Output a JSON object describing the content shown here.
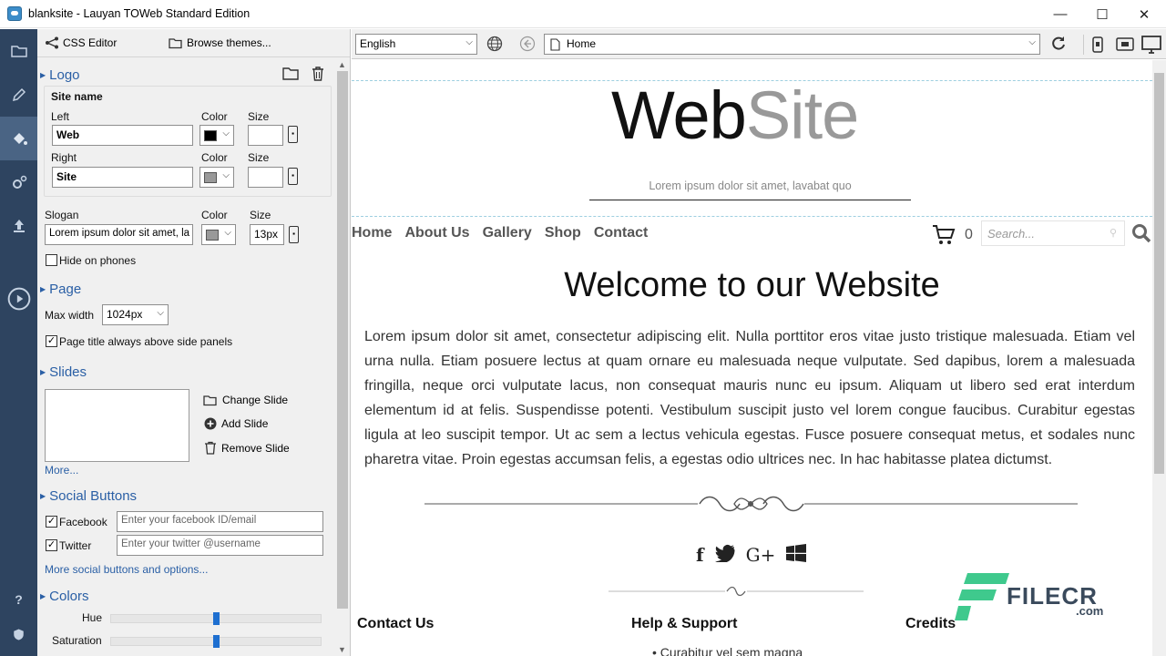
{
  "window": {
    "title": "blanksite - Lauyan TOWeb Standard Edition",
    "minimize": "—",
    "maximize": "☐",
    "close": "✕"
  },
  "panel_toolbar": {
    "css_editor": "CSS Editor",
    "browse_themes": "Browse themes..."
  },
  "logo": {
    "section": "Logo",
    "site_name": "Site name",
    "left_label": "Left",
    "left_value": "Web",
    "right_label": "Right",
    "right_value": "Site",
    "color_label": "Color",
    "size_label": "Size",
    "left_color": "#000000",
    "right_color": "#999999"
  },
  "slogan": {
    "label": "Slogan",
    "value": "Lorem ipsum dolor sit amet, la",
    "color_label": "Color",
    "size_label": "Size",
    "size_value": "13px",
    "color": "#999999",
    "hide_label": "Hide on phones"
  },
  "page": {
    "section": "Page",
    "max_width_label": "Max width",
    "max_width_value": "1024px",
    "title_above_label": "Page title always above side panels"
  },
  "slides": {
    "section": "Slides",
    "change": "Change Slide",
    "add": "Add Slide",
    "remove": "Remove Slide",
    "more": "More..."
  },
  "social": {
    "section": "Social Buttons",
    "facebook_label": "Facebook",
    "facebook_placeholder": "Enter your facebook ID/email",
    "twitter_label": "Twitter",
    "twitter_placeholder": "Enter your twitter @username",
    "more": "More social buttons and options..."
  },
  "colors": {
    "section": "Colors",
    "hue_label": "Hue",
    "saturation_label": "Saturation",
    "hue_value": 0.5,
    "saturation_value": 0.5
  },
  "topbar": {
    "language": "English",
    "page": "Home"
  },
  "help": "?",
  "site": {
    "logo_left": "Web",
    "logo_right": "Site",
    "slogan": "Lorem ipsum dolor sit amet, lavabat quo",
    "nav": [
      "Home",
      "About Us",
      "Gallery",
      "Shop",
      "Contact"
    ],
    "cart_count": "0",
    "search_placeholder": "Search...",
    "heading": "Welcome to our Website",
    "body": "Lorem ipsum dolor sit amet, consectetur adipiscing elit. Nulla porttitor eros vitae justo tristique malesuada. Etiam vel urna nulla. Etiam posuere lectus at quam ornare eu malesuada neque vulputate. Sed dapibus, lorem a malesuada fringilla, neque orci vulputate lacus, non consequat mauris nunc eu ipsum. Aliquam ut libero sed erat interdum elementum id at felis. Suspendisse potenti. Vestibulum suscipit justo vel lorem congue faucibus. Curabitur egestas ligula at leo suscipit tempor. Ut ac sem a lectus vehicula egestas. Fusce posuere consequat metus, et sodales nunc pharetra vitae. Proin egestas accumsan felis, a egestas odio ultrices nec. In hac habitasse platea dictumst.",
    "footer": [
      "Contact Us",
      "Help & Support",
      "Credits"
    ],
    "footer_item": "Curabitur vel sem magna"
  },
  "watermark": {
    "brand": "FILECR",
    "tld": ".com"
  }
}
